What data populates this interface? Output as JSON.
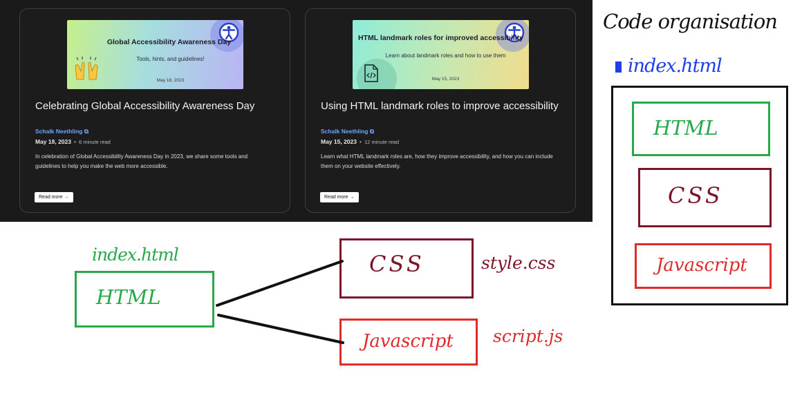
{
  "blog": {
    "read_more_label": "Read more →",
    "posts": [
      {
        "thumb_title": "Global Accessibility Awareness Day",
        "thumb_sub": "Tools, hints, and guidelines!",
        "thumb_date": "May 18, 2023",
        "title": "Celebrating Global Accessibility Awareness Day",
        "author": "Schalk Neethling",
        "date": "May 18, 2023",
        "read_time": "6 minute read",
        "excerpt": "In celebration of Global Accessibility Awareness Day in 2023, we share some tools and guidelines to help you make the web more accessible."
      },
      {
        "thumb_title": "HTML landmark roles for improved accessibility",
        "thumb_sub": "Learn about landmark roles and how to use them",
        "thumb_date": "May 15, 2023",
        "title": "Using HTML landmark roles to improve accessibility",
        "author": "Schalk Neethling",
        "date": "May 15, 2023",
        "read_time": "12 minute read",
        "excerpt": "Learn what HTML landmark roles are, how they improve accessibility, and how you can include them on your website effectively."
      }
    ]
  },
  "diagram": {
    "right_title": "Code organisation",
    "right_index": "index.html",
    "org_html": "HTML",
    "org_css": "CSS",
    "org_js": "Javascript",
    "left_index": "index.html",
    "html_box": "HTML",
    "css_box": "CSS",
    "js_box": "Javascript",
    "css_file": "style.css",
    "js_file": "script.js"
  },
  "colors": {
    "html_green": "#27a84a",
    "css_maroon": "#7a1626",
    "js_red": "#df2a2a",
    "index_blue": "#1f3fe8",
    "author_blue": "#6aa7ff"
  }
}
